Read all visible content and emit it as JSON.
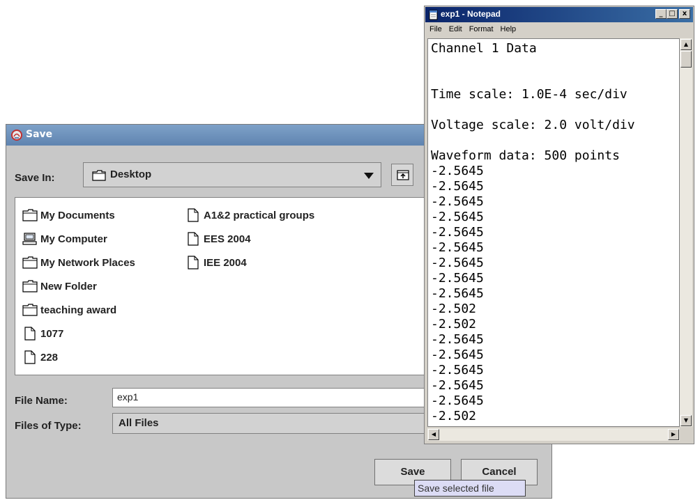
{
  "save_dialog": {
    "title": "Save",
    "save_in_label": "Save In:",
    "save_in_value": "Desktop",
    "files": [
      {
        "name": "My Documents",
        "icon": "folder-icon"
      },
      {
        "name": "My Computer",
        "icon": "computer-icon"
      },
      {
        "name": "My Network Places",
        "icon": "folder-icon"
      },
      {
        "name": "New Folder",
        "icon": "folder-icon"
      },
      {
        "name": "teaching award",
        "icon": "folder-icon"
      },
      {
        "name": "1077",
        "icon": "file-icon"
      },
      {
        "name": "228",
        "icon": "file-icon"
      },
      {
        "name": "A1&2 practical groups",
        "icon": "file-icon"
      },
      {
        "name": "EES 2004",
        "icon": "file-icon"
      },
      {
        "name": "IEE 2004",
        "icon": "file-icon"
      }
    ],
    "file_name_label": "File Name:",
    "file_name_value": "exp1",
    "files_of_type_label": "Files of Type:",
    "files_of_type_value": "All Files",
    "save_button": "Save",
    "cancel_button": "Cancel",
    "tooltip": "Save selected file"
  },
  "notepad": {
    "title": "exp1 - Notepad",
    "menu": [
      "File",
      "Edit",
      "Format",
      "Help"
    ],
    "lines": [
      "Channel 1 Data",
      "",
      "",
      "Time scale: 1.0E-4 sec/div",
      "",
      "Voltage scale: 2.0 volt/div",
      "",
      "Waveform data: 500 points",
      "-2.5645",
      "-2.5645",
      "-2.5645",
      "-2.5645",
      "-2.5645",
      "-2.5645",
      "-2.5645",
      "-2.5645",
      "-2.5645",
      "-2.502",
      "-2.502",
      "-2.5645",
      "-2.5645",
      "-2.5645",
      "-2.5645",
      "-2.5645",
      "-2.502"
    ],
    "controls": {
      "minimize": "_",
      "maximize": "□",
      "close": "x"
    }
  },
  "colors": {
    "dialog_bg": "#c8c8c8",
    "dialog_title": "#6b8fba",
    "notepad_title": "#0a246a",
    "tooltip_bg": "#dcdcf5"
  }
}
